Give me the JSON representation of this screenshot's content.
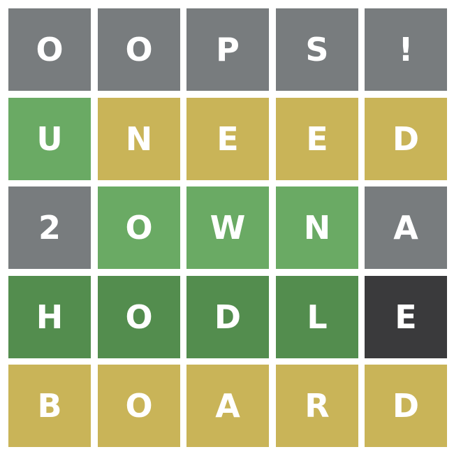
{
  "colors": {
    "gray": "#787c7e",
    "present": "#c9b458",
    "correct_light": "#6aaa64",
    "correct_dark": "#538d4e",
    "dark": "#3a3a3c"
  },
  "board": {
    "rows": [
      {
        "tiles": [
          {
            "letter": "O",
            "state": "gray"
          },
          {
            "letter": "O",
            "state": "gray"
          },
          {
            "letter": "P",
            "state": "gray"
          },
          {
            "letter": "S",
            "state": "gray"
          },
          {
            "letter": "!",
            "state": "gray"
          }
        ]
      },
      {
        "tiles": [
          {
            "letter": "U",
            "state": "correct_light"
          },
          {
            "letter": "N",
            "state": "present"
          },
          {
            "letter": "E",
            "state": "present"
          },
          {
            "letter": "E",
            "state": "present"
          },
          {
            "letter": "D",
            "state": "present"
          }
        ]
      },
      {
        "tiles": [
          {
            "letter": "2",
            "state": "gray"
          },
          {
            "letter": "O",
            "state": "correct_light"
          },
          {
            "letter": "W",
            "state": "correct_light"
          },
          {
            "letter": "N",
            "state": "correct_light"
          },
          {
            "letter": "A",
            "state": "gray"
          }
        ]
      },
      {
        "tiles": [
          {
            "letter": "H",
            "state": "correct_dark"
          },
          {
            "letter": "O",
            "state": "correct_dark"
          },
          {
            "letter": "D",
            "state": "correct_dark"
          },
          {
            "letter": "L",
            "state": "correct_dark"
          },
          {
            "letter": "E",
            "state": "dark"
          }
        ]
      },
      {
        "tiles": [
          {
            "letter": "B",
            "state": "present"
          },
          {
            "letter": "O",
            "state": "present"
          },
          {
            "letter": "A",
            "state": "present"
          },
          {
            "letter": "R",
            "state": "present"
          },
          {
            "letter": "D",
            "state": "present"
          }
        ]
      }
    ]
  }
}
